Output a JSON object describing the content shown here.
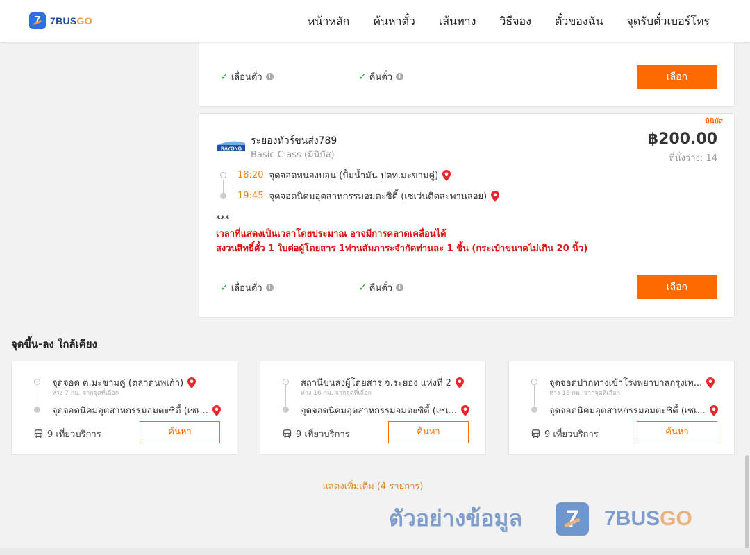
{
  "header": {
    "logo_number": "7",
    "logo_text_main": "7BUS",
    "logo_text_go": "GO",
    "nav": [
      "หน้าหลัก",
      "ค้นหาตั๋ว",
      "เส้นทาง",
      "วิธีจอง",
      "ตั๋วของฉัน",
      "จุดรับตั๋วเบอร์โทร"
    ]
  },
  "top_card": {
    "reschedule": "เลื่อนตั๋ว",
    "refund": "คืนตั๋ว",
    "select_label": "เลือก"
  },
  "trip": {
    "tag": "มินิบัส",
    "company_logo_text": "RAYONG",
    "company": "ระยองทัวร์ขนส่ง789",
    "class": "Basic Class (มินิบัส)",
    "price": "฿200.00",
    "seats": "ที่นั่งว่าง: 14",
    "departure_time": "18:20",
    "departure_stop": "จุดจอดหนองบอน (ปั้มน้ำมัน ปตท.มะขามคู่)",
    "arrival_time": "19:45",
    "arrival_stop": "จุดจอดนิคมอุตสาหกรรมอมตะซิตี้ (เซเว่นติดสะพานลอย)",
    "note_stars": "***",
    "note_line1": "เวลาที่แสดงเป็นเวลาโดยประมาณ อาจมีการคลาดเคลื่อนได้",
    "note_line2": "สงวนสิทธิ์ตั๋ว 1 ใบต่อผู้โดยสาร 1ท่านสัมภาระจำกัดท่านละ 1 ชิ้น (กระเป๋าขนาดไม่เกิน 20 นิ้ว)",
    "reschedule": "เลื่อนตั๋ว",
    "refund": "คืนตั๋ว",
    "select_label": "เลือก"
  },
  "nearby": {
    "title": "จุดขึ้น-ลง ใกล้เคียง",
    "items": [
      {
        "from": "จุดจอด ต.มะขามคู่ (ตลาดนพเก้า)",
        "distance": "ห่าง 7 กม. จากจุดที่เลือก",
        "to": "จุดจอดนิคมอุตสาหกรรมอมตะซิตี้ (เซเ...",
        "trips": "9 เที่ยวบริการ",
        "button": "ค้นหา"
      },
      {
        "from": "สถานีขนส่งผู้โดยสาร จ.ระยอง แห่งที่ 2",
        "distance": "ห่าง 16 กม. จากจุดที่เลือก",
        "to": "จุดจอดนิคมอุตสาหกรรมอมตะซิตี้ (เซเ...",
        "trips": "9 เที่ยวบริการ",
        "button": "ค้นหา"
      },
      {
        "from": "จุดจอดปากทางเข้าโรงพยาบาลกรุงเท...",
        "distance": "ห่าง 18 กม. จากจุดที่เลือก",
        "to": "จุดจอดนิคมอุตสาหกรรมอมตะซิตี้ (เซเ...",
        "trips": "9 เที่ยวบริการ",
        "button": "ค้นหา"
      }
    ],
    "show_more": "แสดงเพิ่มเติม (4 รายการ)"
  },
  "watermark": {
    "text": "ตัวอย่างข้อมูล",
    "badge_number": "7",
    "brand_main": "7BUS",
    "brand_go": "GO"
  },
  "colors": {
    "accent": "#ff6a00",
    "time": "#e6861f",
    "warning": "#e0120f",
    "check": "#2a9d34",
    "brand_blue": "#2d6fe0"
  }
}
